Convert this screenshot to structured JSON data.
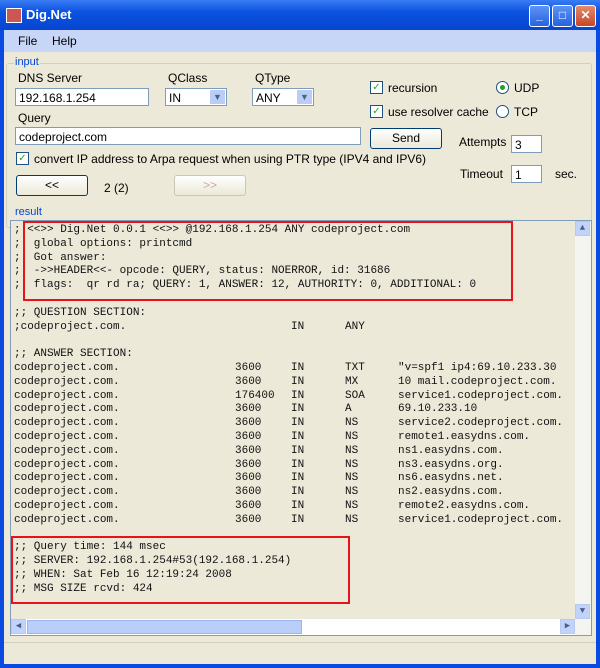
{
  "window": {
    "title": "Dig.Net",
    "min": "_",
    "max": "□",
    "close": "✕"
  },
  "menu": [
    "File",
    "Help"
  ],
  "input": {
    "group_label": "input",
    "dns_server_label": "DNS Server",
    "dns_server_value": "192.168.1.254",
    "qclass_label": "QClass",
    "qclass_value": "IN",
    "qtype_label": "QType",
    "qtype_value": "ANY",
    "query_label": "Query",
    "query_value": "codeproject.com",
    "recursion_label": "recursion",
    "recursion_checked": true,
    "resolver_cache_label": "use resolver cache",
    "resolver_cache_checked": true,
    "udp_label": "UDP",
    "tcp_label": "TCP",
    "protocol_selected": "UDP",
    "send_label": "Send",
    "attempts_label": "Attempts",
    "attempts_value": "3",
    "timeout_label": "Timeout",
    "timeout_value": "1",
    "timeout_unit": "sec.",
    "arpa_label": "convert IP address to Arpa request when using PTR type (IPV4 and IPV6)",
    "arpa_checked": true,
    "prev_label": "<<",
    "next_label": ">>",
    "page_indicator": "2 (2)"
  },
  "result": {
    "group_label": "result",
    "header_lines": [
      "; <<>> Dig.Net 0.0.1 <<>> @192.168.1.254 ANY codeproject.com",
      ";  global options: printcmd",
      ";  Got answer:",
      ";  ->>HEADER<<- opcode: QUERY, status: NOERROR, id: 31686",
      ";  flags:  qr rd ra; QUERY: 1, ANSWER: 12, AUTHORITY: 0, ADDITIONAL: 0"
    ],
    "question_header": ";; QUESTION SECTION:",
    "question": {
      "name": ";codeproject.com.",
      "class": "IN",
      "type": "ANY"
    },
    "answer_header": ";; ANSWER SECTION:",
    "answers": [
      {
        "name": "codeproject.com.",
        "ttl": "3600",
        "class": "IN",
        "type": "TXT",
        "data": "\"v=spf1 ip4:69.10.233.30"
      },
      {
        "name": "codeproject.com.",
        "ttl": "3600",
        "class": "IN",
        "type": "MX",
        "data": "10 mail.codeproject.com."
      },
      {
        "name": "codeproject.com.",
        "ttl": "176400",
        "class": "IN",
        "type": "SOA",
        "data": "service1.codeproject.com."
      },
      {
        "name": "codeproject.com.",
        "ttl": "3600",
        "class": "IN",
        "type": "A",
        "data": "69.10.233.10"
      },
      {
        "name": "codeproject.com.",
        "ttl": "3600",
        "class": "IN",
        "type": "NS",
        "data": "service2.codeproject.com."
      },
      {
        "name": "codeproject.com.",
        "ttl": "3600",
        "class": "IN",
        "type": "NS",
        "data": "remote1.easydns.com."
      },
      {
        "name": "codeproject.com.",
        "ttl": "3600",
        "class": "IN",
        "type": "NS",
        "data": "ns1.easydns.com."
      },
      {
        "name": "codeproject.com.",
        "ttl": "3600",
        "class": "IN",
        "type": "NS",
        "data": "ns3.easydns.org."
      },
      {
        "name": "codeproject.com.",
        "ttl": "3600",
        "class": "IN",
        "type": "NS",
        "data": "ns6.easydns.net."
      },
      {
        "name": "codeproject.com.",
        "ttl": "3600",
        "class": "IN",
        "type": "NS",
        "data": "ns2.easydns.com."
      },
      {
        "name": "codeproject.com.",
        "ttl": "3600",
        "class": "IN",
        "type": "NS",
        "data": "remote2.easydns.com."
      },
      {
        "name": "codeproject.com.",
        "ttl": "3600",
        "class": "IN",
        "type": "NS",
        "data": "service1.codeproject.com."
      }
    ],
    "footer_lines": [
      ";; Query time: 144 msec",
      ";; SERVER: 192.168.1.254#53(192.168.1.254)",
      ";; WHEN: Sat Feb 16 12:19:24 2008",
      ";; MSG SIZE rcvd: 424"
    ]
  },
  "colors": {
    "highlight_box": "#e8121a",
    "title_bar": "#0a52e0",
    "group_label": "#0046d5"
  }
}
